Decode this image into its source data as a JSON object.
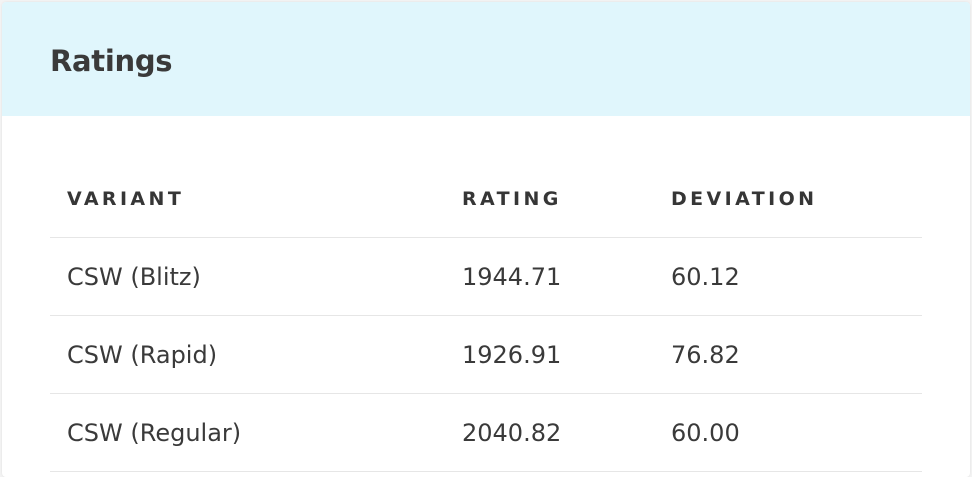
{
  "card": {
    "title": "Ratings"
  },
  "table": {
    "headers": [
      "VARIANT",
      "RATING",
      "DEVIATION"
    ],
    "rows": [
      {
        "variant": "CSW (Blitz)",
        "rating": "1944.71",
        "deviation": "60.12"
      },
      {
        "variant": "CSW (Rapid)",
        "rating": "1926.91",
        "deviation": "76.82"
      },
      {
        "variant": "CSW (Regular)",
        "rating": "2040.82",
        "deviation": "60.00"
      }
    ]
  },
  "colors": {
    "header_background": "#e0f6fc",
    "text": "#3a3a3a",
    "divider": "#e6e6e6"
  }
}
